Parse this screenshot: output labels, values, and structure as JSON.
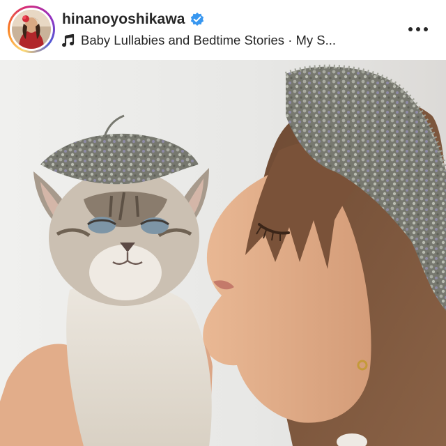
{
  "post": {
    "username": "hinanoyoshikawa",
    "verified_icon": "verified-badge-icon",
    "audio": {
      "icon": "music-note-icon",
      "text": "Baby Lullabies and Bedtime Stories · My S..."
    },
    "more_icon": "more-options-icon",
    "media": {
      "subject_alt": "woman wearing a dried lavender wreath holding a kitten that also wears a lavender crown"
    }
  },
  "colors": {
    "username": "#262626",
    "verified": "#3897f0",
    "story_ring_start": "#feda75",
    "story_ring_end": "#962fbf",
    "photo_background": "#ebebe9"
  }
}
